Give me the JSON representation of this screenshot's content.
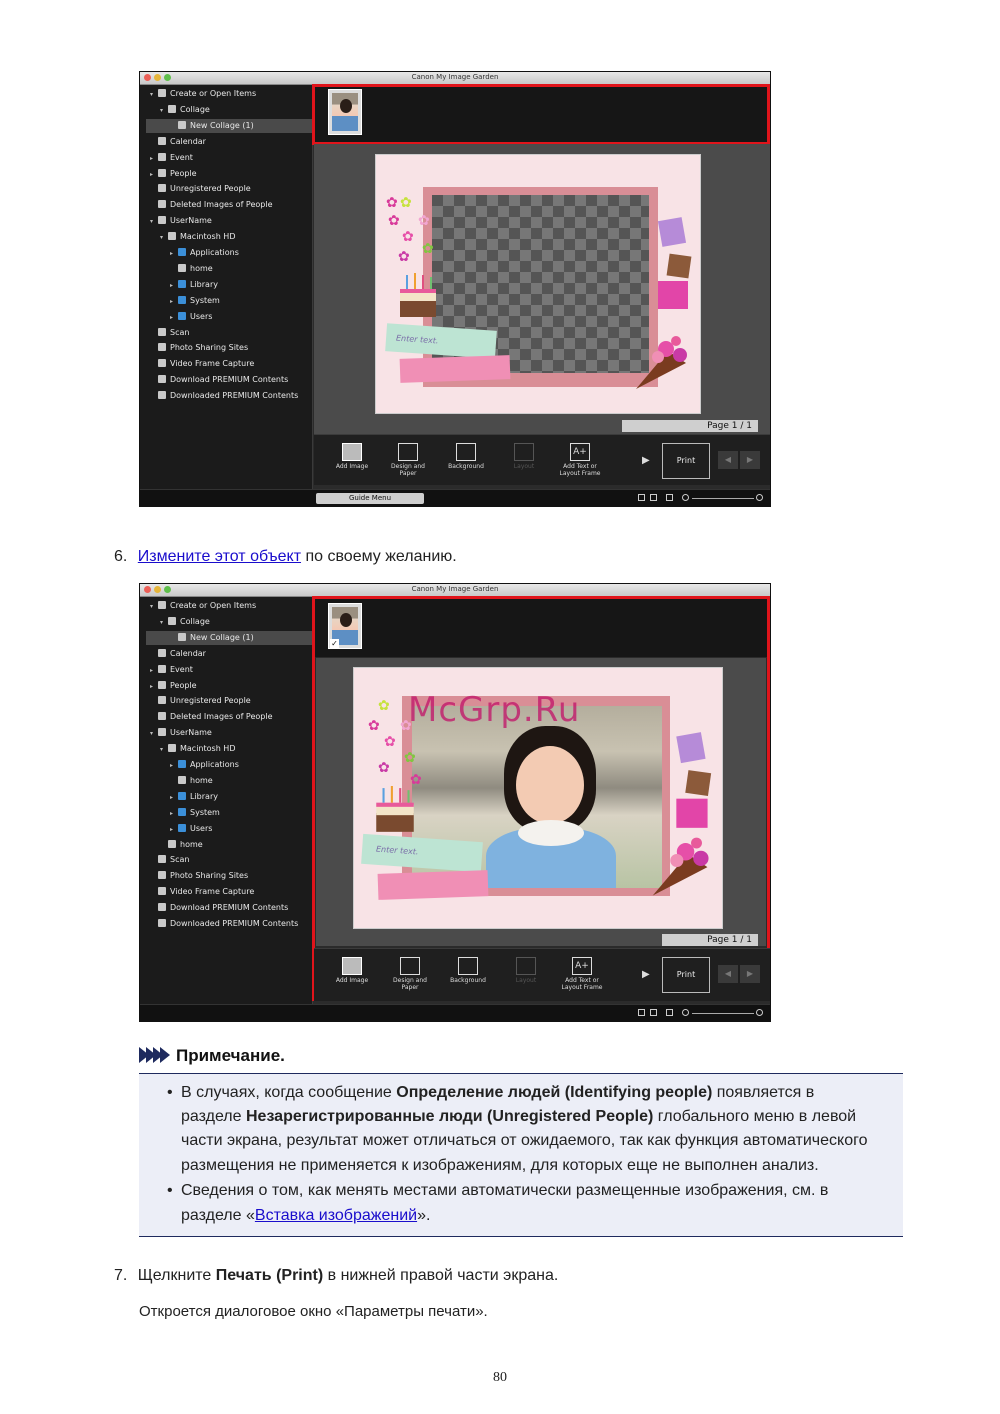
{
  "app": {
    "title": "Canon My Image Garden",
    "sidebar1": [
      {
        "label": "Create or Open Items",
        "indent": 0,
        "tri": "▾"
      },
      {
        "label": "Collage",
        "indent": 1,
        "tri": "▾"
      },
      {
        "label": "New Collage (1)",
        "indent": 2,
        "tri": "",
        "selected": true
      },
      {
        "label": "Calendar",
        "indent": 0,
        "tri": ""
      },
      {
        "label": "Event",
        "indent": 0,
        "tri": "▸"
      },
      {
        "label": "People",
        "indent": 0,
        "tri": "▸"
      },
      {
        "label": "Unregistered People",
        "indent": 0,
        "tri": ""
      },
      {
        "label": "Deleted Images of People",
        "indent": 0,
        "tri": ""
      },
      {
        "label": "UserName",
        "indent": 0,
        "tri": "▾"
      },
      {
        "label": "Macintosh HD",
        "indent": 1,
        "tri": "▾"
      },
      {
        "label": "Applications",
        "indent": 2,
        "tri": "▸",
        "folder": true
      },
      {
        "label": "home",
        "indent": 2,
        "tri": ""
      },
      {
        "label": "Library",
        "indent": 2,
        "tri": "▸",
        "folder": true
      },
      {
        "label": "System",
        "indent": 2,
        "tri": "▸",
        "folder": true
      },
      {
        "label": "Users",
        "indent": 2,
        "tri": "▸",
        "folder": true
      },
      {
        "label": "Scan",
        "indent": 0,
        "tri": ""
      },
      {
        "label": "Photo Sharing Sites",
        "indent": 0,
        "tri": ""
      },
      {
        "label": "Video Frame Capture",
        "indent": 0,
        "tri": ""
      },
      {
        "label": "Download PREMIUM Contents",
        "indent": 0,
        "tri": ""
      },
      {
        "label": "Downloaded PREMIUM Contents",
        "indent": 0,
        "tri": ""
      }
    ],
    "sidebar2": [
      {
        "label": "Create or Open Items",
        "indent": 0,
        "tri": "▾"
      },
      {
        "label": "Collage",
        "indent": 1,
        "tri": "▾"
      },
      {
        "label": "New Collage (1)",
        "indent": 2,
        "tri": "",
        "selected": true
      },
      {
        "label": "Calendar",
        "indent": 0,
        "tri": ""
      },
      {
        "label": "Event",
        "indent": 0,
        "tri": "▸"
      },
      {
        "label": "People",
        "indent": 0,
        "tri": "▸"
      },
      {
        "label": "Unregistered People",
        "indent": 0,
        "tri": ""
      },
      {
        "label": "Deleted Images of People",
        "indent": 0,
        "tri": ""
      },
      {
        "label": "UserName",
        "indent": 0,
        "tri": "▾"
      },
      {
        "label": "Macintosh HD",
        "indent": 1,
        "tri": "▾"
      },
      {
        "label": "Applications",
        "indent": 2,
        "tri": "▸",
        "folder": true
      },
      {
        "label": "home",
        "indent": 2,
        "tri": ""
      },
      {
        "label": "Library",
        "indent": 2,
        "tri": "▸",
        "folder": true
      },
      {
        "label": "System",
        "indent": 2,
        "tri": "▸",
        "folder": true
      },
      {
        "label": "Users",
        "indent": 2,
        "tri": "▸",
        "folder": true
      },
      {
        "label": "home",
        "indent": 1,
        "tri": ""
      },
      {
        "label": "Scan",
        "indent": 0,
        "tri": ""
      },
      {
        "label": "Photo Sharing Sites",
        "indent": 0,
        "tri": ""
      },
      {
        "label": "Video Frame Capture",
        "indent": 0,
        "tri": ""
      },
      {
        "label": "Download PREMIUM Contents",
        "indent": 0,
        "tri": ""
      },
      {
        "label": "Downloaded PREMIUM Contents",
        "indent": 0,
        "tri": ""
      }
    ],
    "toolbar": {
      "add_image": "Add Image",
      "design_paper_1": "Design and",
      "design_paper_2": "Paper",
      "background": "Background",
      "layout": "Layout",
      "add_text_1": "Add Text or",
      "add_text_2": "Layout Frame",
      "print": "Print"
    },
    "page_indicator": "Page 1 / 1",
    "guide_menu": "Guide Menu",
    "enter_text": "Enter text.",
    "highlight_color": "#e0141b",
    "icons": [
      "folder-icon",
      "calendar-icon",
      "person-icon",
      "computer-icon",
      "scan-icon",
      "chevron-right-icon",
      "zoom-in-icon",
      "zoom-out-icon"
    ]
  },
  "doc": {
    "step6_num": "6.",
    "step6_link": "Измените этот объект",
    "step6_rest": " по своему желанию.",
    "watermark": "McGrp.Ru",
    "note_title": "Примечание.",
    "note1_l1a": "В случаях, когда сообщение ",
    "note1_l1b": "Определение людей (Identifying people)",
    "note1_l1c": " появляется в",
    "note1_l2a": "разделе ",
    "note1_l2b": "Незарегистрированные люди (Unregistered People)",
    "note1_l2c": " глобального меню в левой",
    "note1_l3": "части экрана, результат может отличаться от ожидаемого, так как функция автоматического",
    "note1_l4": "размещения не применяется к изображениям, для которых еще не выполнен анализ.",
    "note2_l1": "Сведения о том, как менять местами автоматически размещенные изображения, см. в",
    "note2_l2a": "разделе «",
    "note2_link": "Вставка изображений",
    "note2_l2c": "».",
    "bullet": "•",
    "step7_num": "7.",
    "step7_a": "Щелкните ",
    "step7_b": "Печать (Print)",
    "step7_c": " в нижней правой части экрана.",
    "step7_sub": "Откроется диалоговое окно «Параметры печати».",
    "page_number": "80"
  }
}
